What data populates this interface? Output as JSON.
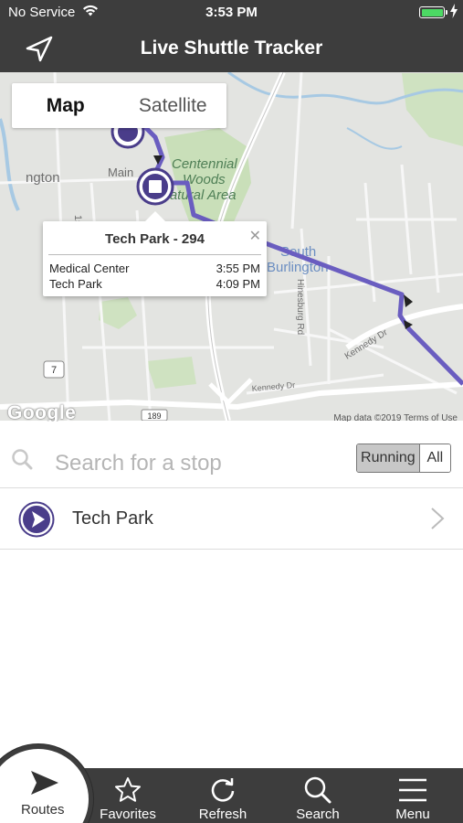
{
  "status_bar": {
    "carrier": "No Service",
    "time": "3:53 PM"
  },
  "nav_bar": {
    "title": "Live Shuttle Tracker",
    "locate_icon": "location-arrow-icon"
  },
  "map": {
    "map_type": {
      "map_label": "Map",
      "satellite_label": "Satellite",
      "selected": "Map"
    },
    "labels": {
      "centennial": "Centennial",
      "woods": "Woods",
      "natural_area": "Natural Area",
      "south": "South",
      "burlington": "Burlington",
      "ngton": "ngton",
      "main": "Main",
      "hinesburg": "Hinesburg Rd",
      "kennedy_dr_1": "Kennedy Dr",
      "kennedy_dr_2": "Kennedy Dr",
      "route7": "7",
      "route189": "189",
      "st": "1st"
    },
    "google_logo": "Google",
    "attribution": "Map data ©2019   Terms of Use",
    "route_color": "#6a5dc0",
    "info_window": {
      "title": "Tech Park - 294",
      "stops": [
        {
          "name": "Medical Center",
          "time": "3:55 PM"
        },
        {
          "name": "Tech Park",
          "time": "4:09 PM"
        }
      ]
    }
  },
  "search": {
    "placeholder": "Search for a stop",
    "value": ""
  },
  "filter": {
    "running_label": "Running",
    "all_label": "All",
    "selected": "Running"
  },
  "routes": [
    {
      "label": "Tech Park",
      "icon": "play-circle-icon"
    }
  ],
  "tab_bar": {
    "routes": "Routes",
    "favorites": "Favorites",
    "refresh": "Refresh",
    "search": "Search",
    "menu": "Menu"
  },
  "colors": {
    "bar_bg": "#3d3d3d",
    "accent": "#4a3d8a",
    "battery": "#4cd964"
  }
}
